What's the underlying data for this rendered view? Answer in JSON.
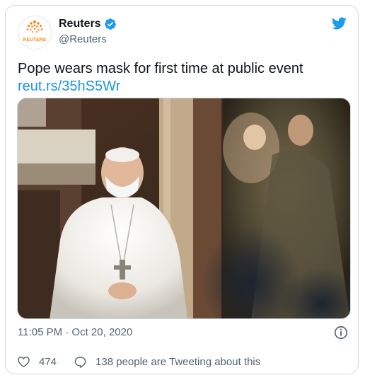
{
  "account": {
    "name": "Reuters",
    "handle": "@Reuters",
    "avatar_text": "REUTERS",
    "verified": true
  },
  "tweet": {
    "text": "Pope wears mask for first time at public event",
    "link": "reut.rs/35hS5Wr",
    "timestamp": "11:05 PM · Oct 20, 2020"
  },
  "actions": {
    "likes": "474",
    "conversation": "138 people are Tweeting about this"
  },
  "icons": {
    "brand": "twitter-bird-icon",
    "verified": "verified-badge-icon",
    "info": "info-icon",
    "like": "heart-icon",
    "reply": "speech-bubble-icon"
  },
  "colors": {
    "brand_blue": "#1d9bf0",
    "link_blue": "#1b95e0",
    "reuters_orange": "#ff8000",
    "secondary_text": "#536471"
  },
  "media": {
    "image_alt": "photo-of-pope-wearing-white-face-mask"
  }
}
